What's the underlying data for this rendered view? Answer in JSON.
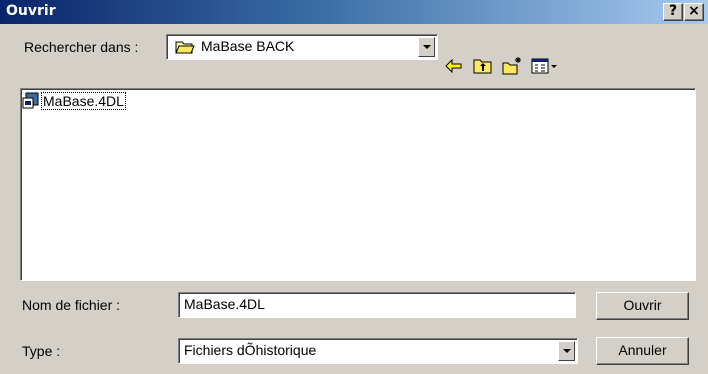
{
  "window": {
    "title": "Ouvrir",
    "help_label": "?",
    "close_label": "×"
  },
  "lookin": {
    "label": "Rechercher dans :",
    "value": "MaBase BACK"
  },
  "toolbar": {
    "icons": [
      "back-arrow-icon",
      "up-folder-icon",
      "new-folder-icon",
      "view-menu-icon"
    ]
  },
  "files": [
    {
      "name": "MaBase.4DL",
      "icon": "database-file-icon"
    }
  ],
  "filename": {
    "label": "Nom de fichier :",
    "value": "MaBase.4DL"
  },
  "filetype": {
    "label": "Type :",
    "value": "Fichiers dÕhistorique"
  },
  "buttons": {
    "open": "Ouvrir",
    "cancel": "Annuler"
  }
}
